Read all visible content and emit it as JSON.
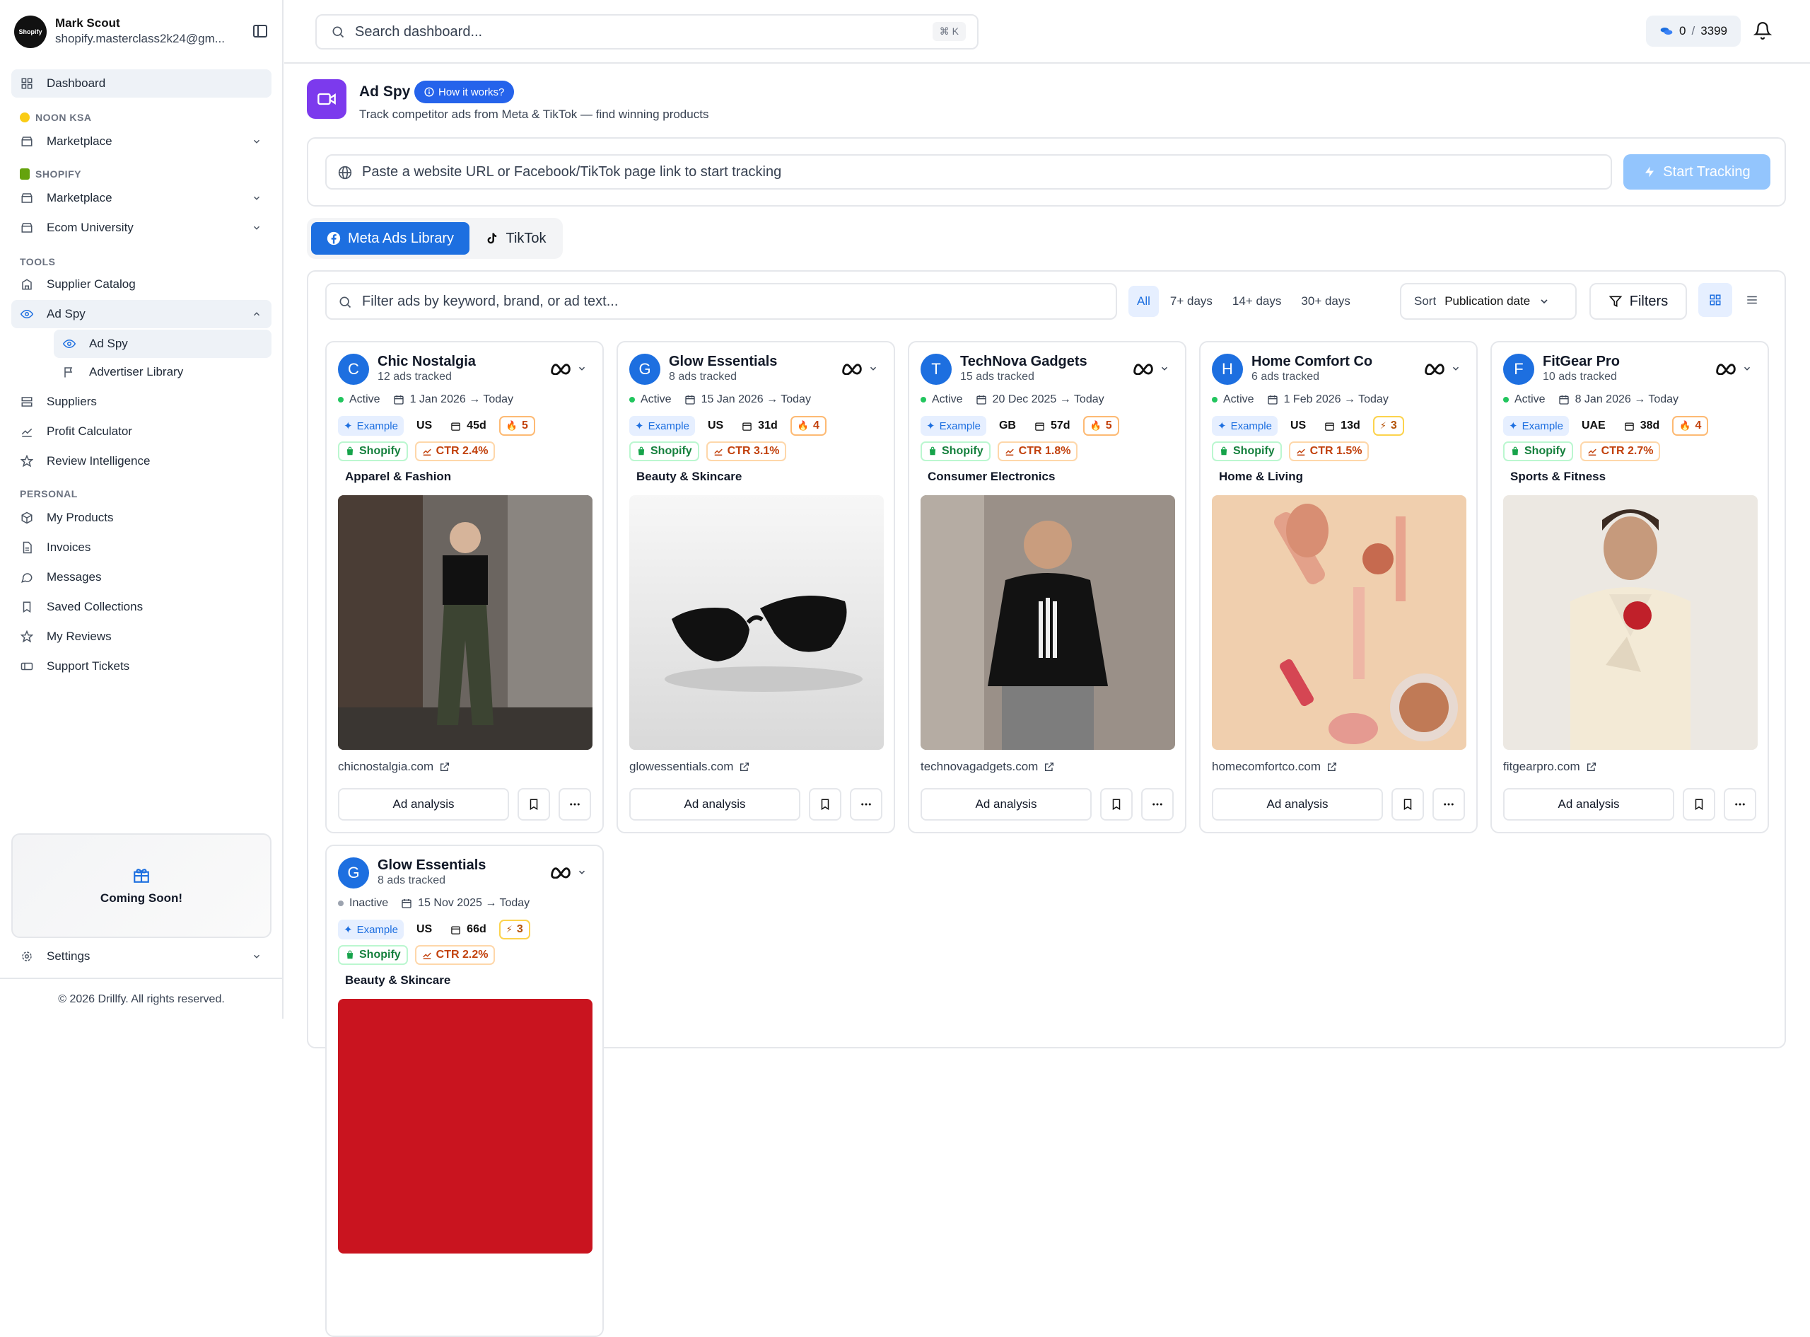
{
  "user": {
    "name": "Mark Scout",
    "email": "shopify.masterclass2k24@gm...",
    "avatar_text": "Shopify"
  },
  "sidebar": {
    "dashboard": "Dashboard",
    "noon_label": "NOON KSA",
    "noon_marketplace": "Marketplace",
    "shopify_label": "SHOPIFY",
    "shopify_marketplace": "Marketplace",
    "ecom_university": "Ecom University",
    "tools_label": "TOOLS",
    "supplier_catalog": "Supplier Catalog",
    "ad_spy": "Ad Spy",
    "ad_spy_sub": "Ad Spy",
    "advertiser_library": "Advertiser Library",
    "suppliers": "Suppliers",
    "profit_calculator": "Profit Calculator",
    "review_intelligence": "Review Intelligence",
    "personal_label": "PERSONAL",
    "my_products": "My Products",
    "invoices": "Invoices",
    "messages": "Messages",
    "saved_collections": "Saved Collections",
    "my_reviews": "My Reviews",
    "support_tickets": "Support Tickets",
    "coming_soon": "Coming Soon!",
    "settings": "Settings",
    "copyright": "© 2026 Drillfy. All rights reserved."
  },
  "topbar": {
    "search_placeholder": "Search dashboard...",
    "shortcut": "⌘ K",
    "credits_used": "0",
    "credits_sep": "/",
    "credits_total": "3399"
  },
  "page": {
    "title": "Ad Spy",
    "how_label": "How it works?",
    "subtitle": "Track competitor ads from Meta & TikTok — find winning products",
    "url_placeholder": "Paste a website URL or Facebook/TikTok page link to start tracking",
    "start_label": "Start Tracking",
    "tab_meta": "Meta Ads Library",
    "tab_tiktok": "TikTok",
    "filter_placeholder": "Filter ads by keyword, brand, or ad text...",
    "days": [
      "All",
      "7+ days",
      "14+ days",
      "30+ days"
    ],
    "sort_label": "Sort",
    "sort_value": "Publication date",
    "filters_label": "Filters"
  },
  "cards": [
    {
      "initial": "C",
      "name": "Chic Nostalgia",
      "count": "12 ads tracked",
      "status": "Active",
      "dates": "1 Jan 2026 → Today",
      "example": "Example",
      "country": "US",
      "days": "45d",
      "score": "5",
      "store": "Shopify",
      "ctr": "CTR 2.4%",
      "category": "Apparel & Fashion",
      "site": "chicnostalgia.com",
      "analysis": "Ad analysis"
    },
    {
      "initial": "G",
      "name": "Glow Essentials",
      "count": "8 ads tracked",
      "status": "Active",
      "dates": "15 Jan 2026 → Today",
      "example": "Example",
      "country": "US",
      "days": "31d",
      "score": "4",
      "store": "Shopify",
      "ctr": "CTR 3.1%",
      "category": "Beauty & Skincare",
      "site": "glowessentials.com",
      "analysis": "Ad analysis"
    },
    {
      "initial": "T",
      "name": "TechNova Gadgets",
      "count": "15 ads tracked",
      "status": "Active",
      "dates": "20 Dec 2025 → Today",
      "example": "Example",
      "country": "GB",
      "days": "57d",
      "score": "5",
      "store": "Shopify",
      "ctr": "CTR 1.8%",
      "category": "Consumer Electronics",
      "site": "technovagadgets.com",
      "analysis": "Ad analysis"
    },
    {
      "initial": "H",
      "name": "Home Comfort Co",
      "count": "6 ads tracked",
      "status": "Active",
      "dates": "1 Feb 2026 → Today",
      "example": "Example",
      "country": "US",
      "days": "13d",
      "score": "3",
      "store": "Shopify",
      "ctr": "CTR 1.5%",
      "category": "Home & Living",
      "site": "homecomfortco.com",
      "analysis": "Ad analysis"
    },
    {
      "initial": "F",
      "name": "FitGear Pro",
      "count": "10 ads tracked",
      "status": "Active",
      "dates": "8 Jan 2026 → Today",
      "example": "Example",
      "country": "UAE",
      "days": "38d",
      "score": "4",
      "store": "Shopify",
      "ctr": "CTR 2.7%",
      "category": "Sports & Fitness",
      "site": "fitgearpro.com",
      "analysis": "Ad analysis"
    },
    {
      "initial": "G",
      "name": "Glow Essentials",
      "count": "8 ads tracked",
      "status": "Inactive",
      "dates": "15 Nov 2025 → Today",
      "example": "Example",
      "country": "US",
      "days": "66d",
      "score": "3",
      "store": "Shopify",
      "ctr": "CTR 2.2%",
      "category": "Beauty & Skincare"
    }
  ],
  "colors": {
    "primary": "#1d6fe0",
    "active": "#22c55e",
    "purple": "#7c3aed"
  }
}
